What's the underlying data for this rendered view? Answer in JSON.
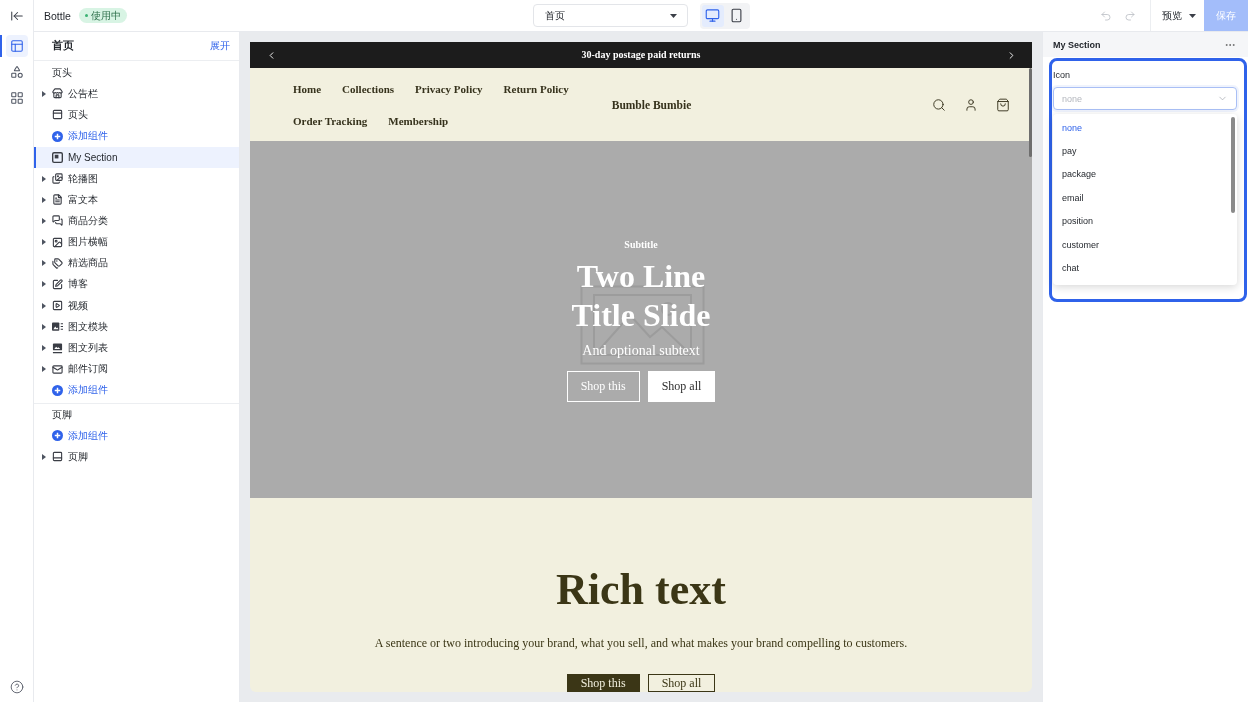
{
  "rail": {
    "items": [
      {
        "selected": true
      },
      {
        "selected": false
      },
      {
        "selected": false
      }
    ]
  },
  "topbar": {
    "site_name": "Bottle",
    "status_badge": "使用中",
    "page_select": {
      "value": "首页"
    },
    "devices": [
      {
        "kind": "desktop",
        "selected": true
      },
      {
        "kind": "mobile",
        "selected": false
      }
    ],
    "undo": {
      "disabled": true
    },
    "redo": {
      "disabled": true
    },
    "preview_button": "预览",
    "save_button": {
      "label": "保存",
      "disabled": true
    }
  },
  "sidebar": {
    "title": "首页",
    "expand_link": "展开",
    "groups": [
      {
        "label": "页头",
        "items": [
          {
            "kind": "section",
            "label": "公告栏",
            "expandable": true,
            "selected": false
          },
          {
            "kind": "section",
            "label": "页头",
            "expandable": false,
            "selected": false
          },
          {
            "kind": "add",
            "label": "添加组件"
          }
        ]
      },
      {
        "items": [
          {
            "kind": "section",
            "label": "My Section",
            "expandable": false,
            "selected": true
          },
          {
            "kind": "section",
            "label": "轮播图",
            "expandable": true,
            "selected": false
          },
          {
            "kind": "section",
            "label": "富文本",
            "expandable": true,
            "selected": false
          },
          {
            "kind": "section",
            "label": "商品分类",
            "expandable": true,
            "selected": false
          },
          {
            "kind": "section",
            "label": "图片横幅",
            "expandable": true,
            "selected": false
          },
          {
            "kind": "section",
            "label": "精选商品",
            "expandable": true,
            "selected": false
          },
          {
            "kind": "section",
            "label": "博客",
            "expandable": true,
            "selected": false
          },
          {
            "kind": "section",
            "label": "视频",
            "expandable": true,
            "selected": false
          },
          {
            "kind": "section",
            "label": "图文模块",
            "expandable": true,
            "selected": false
          },
          {
            "kind": "section",
            "label": "图文列表",
            "expandable": true,
            "selected": false
          },
          {
            "kind": "section",
            "label": "邮件订阅",
            "expandable": true,
            "selected": false
          },
          {
            "kind": "add",
            "label": "添加组件"
          }
        ]
      },
      {
        "label": "页脚",
        "items": [
          {
            "kind": "add",
            "label": "添加组件"
          },
          {
            "kind": "section",
            "label": "页脚",
            "expandable": true,
            "selected": false
          }
        ]
      }
    ]
  },
  "preview": {
    "announcement": {
      "text": "30-day postage paid returns"
    },
    "header": {
      "nav": [
        "Home",
        "Collections",
        "Privacy Policy",
        "Return Policy",
        "Order Tracking",
        "Membership"
      ],
      "logo": "Bumble Bumbie"
    },
    "hero": {
      "subtitle": "Subtitle",
      "title_lines": [
        "Two Line",
        "Title Slide"
      ],
      "subtext": "And optional subtext",
      "buttons": [
        {
          "label": "Shop this",
          "kind": "outline"
        },
        {
          "label": "Shop all",
          "kind": "solid"
        }
      ]
    },
    "rich_text": {
      "heading": "Rich text",
      "body": "A sentence or two introducing your brand, what you sell, and what makes your brand compelling to customers.",
      "buttons": [
        {
          "label": "Shop this",
          "kind": "solid"
        },
        {
          "label": "Shop all",
          "kind": "outline"
        }
      ]
    }
  },
  "panel": {
    "title": "My Section",
    "field": {
      "label": "Icon",
      "value": "none",
      "open": true,
      "options": [
        {
          "label": "none",
          "selected": true
        },
        {
          "label": "pay",
          "selected": false
        },
        {
          "label": "package",
          "selected": false
        },
        {
          "label": "email",
          "selected": false
        },
        {
          "label": "position",
          "selected": false
        },
        {
          "label": "customer",
          "selected": false
        },
        {
          "label": "chat",
          "selected": false
        }
      ]
    }
  }
}
